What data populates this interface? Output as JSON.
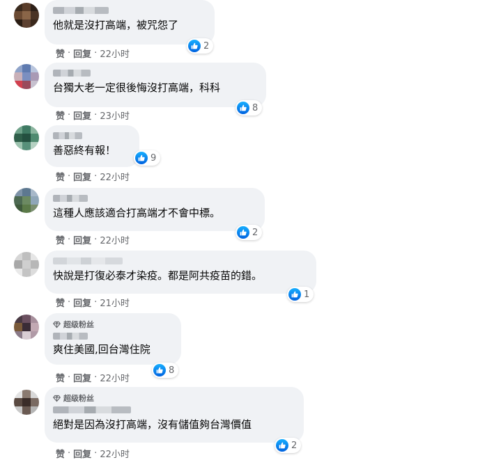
{
  "fan_badge_label": "超级粉丝",
  "actions": {
    "like": "赞",
    "reply": "回复",
    "dot": "·"
  },
  "colors": {
    "bubble": "#f0f2f5",
    "like_blue": "#1877f2",
    "meta_grey": "#65676b"
  },
  "comments": [
    {
      "text": "他就是沒打高端，被咒怨了",
      "reactions": "2",
      "time": "22小时",
      "super_fan": false
    },
    {
      "text": "台獨大老一定很後悔沒打高端，科科",
      "reactions": "8",
      "time": "23小时",
      "super_fan": false
    },
    {
      "text": "善惡終有報！",
      "reactions": "9",
      "time": "22小时",
      "super_fan": false
    },
    {
      "text": "這種人應該適合打高端才不會中標。",
      "reactions": "2",
      "time": "22小时",
      "super_fan": false
    },
    {
      "text": "快說是打復必泰才染疫。都是阿共疫苗的錯。",
      "reactions": "1",
      "time": "21小时",
      "super_fan": false
    },
    {
      "text": "爽住美國,回台灣住院",
      "reactions": "8",
      "time": "22小时",
      "super_fan": true
    },
    {
      "text": "絕對是因為沒打高端，沒有儲值夠台灣價值",
      "reactions": "2",
      "time": "22小时",
      "super_fan": true
    }
  ]
}
